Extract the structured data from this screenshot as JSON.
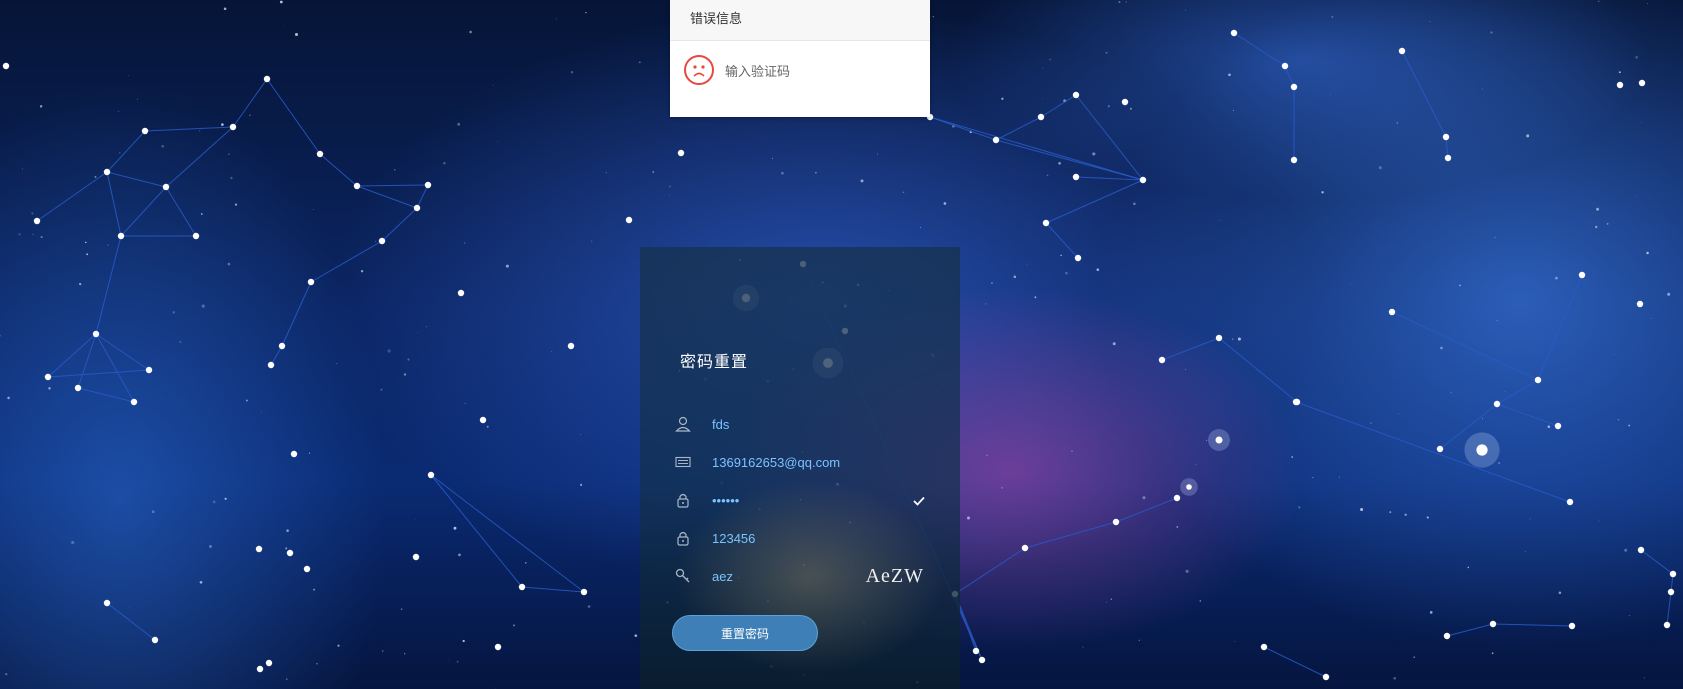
{
  "error_tooltip": {
    "title": "错误信息",
    "message": "输入验证码",
    "icon": "sad-face-icon",
    "icon_color": "#e8483d"
  },
  "panel": {
    "title": "密码重置",
    "fields": [
      {
        "icon": "user-icon",
        "value": "fds"
      },
      {
        "icon": "email-card-icon",
        "value": "1369162653@qq.com"
      },
      {
        "icon": "lock-icon",
        "value": "••••••",
        "validated": true
      },
      {
        "icon": "lock-icon",
        "value": "123456"
      },
      {
        "icon": "key-icon",
        "value": "aez",
        "captcha": "AeZW"
      }
    ],
    "reset_button": "重置密码",
    "accent_color": "#7ac3ff"
  }
}
